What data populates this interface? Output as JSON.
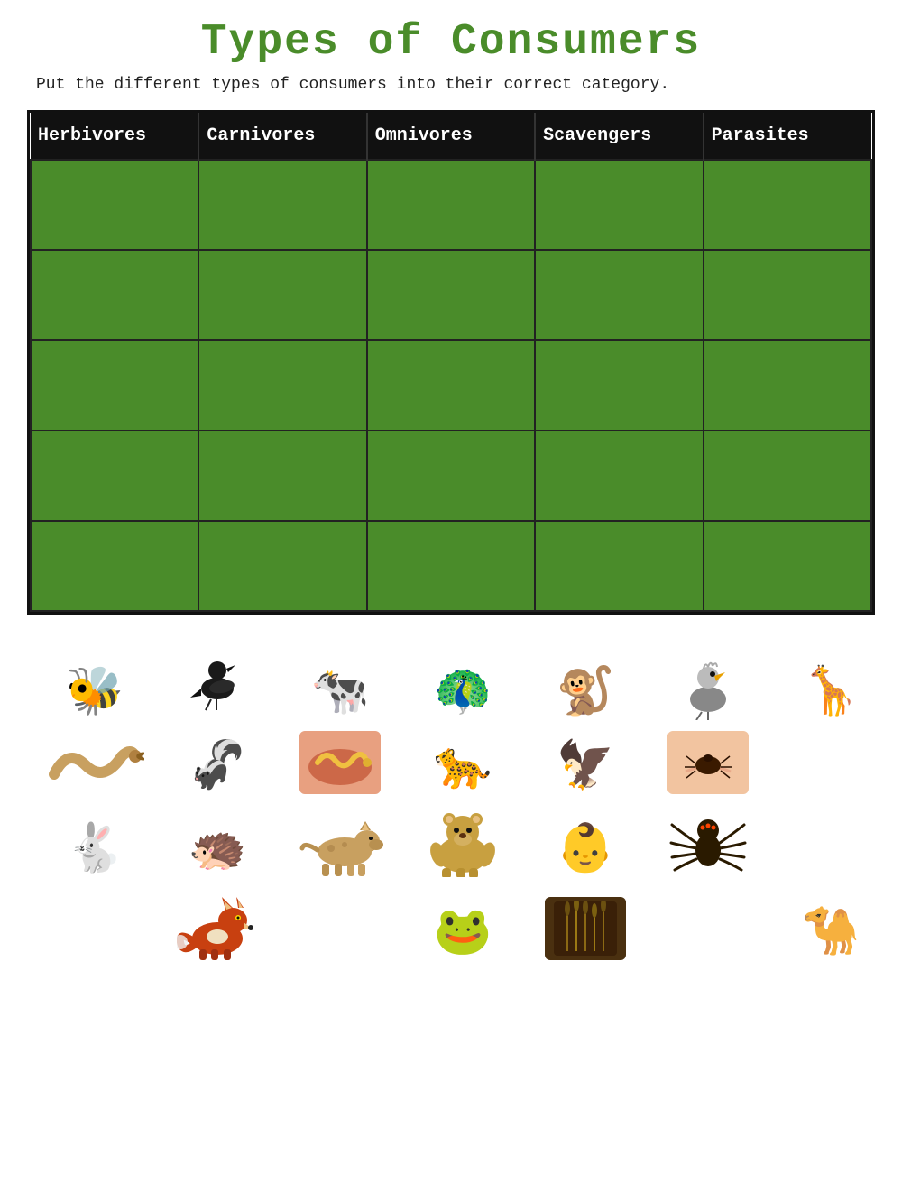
{
  "page": {
    "title": "Types of Consumers",
    "subtitle": "Put the different types of consumers into their correct category.",
    "table": {
      "headers": [
        "Herbivores",
        "Carnivores",
        "Omnivores",
        "Scavengers",
        "Parasites"
      ],
      "rows": 5
    },
    "animals": [
      {
        "id": "bee",
        "icon": "🐝",
        "label": "Bee",
        "size": "normal"
      },
      {
        "id": "crow",
        "icon": "🐦",
        "label": "Crow",
        "size": "normal"
      },
      {
        "id": "cow",
        "icon": "🐄",
        "label": "Cow",
        "size": "normal"
      },
      {
        "id": "peacock",
        "icon": "🦚",
        "label": "Peacock",
        "size": "normal"
      },
      {
        "id": "monkey",
        "icon": "🐒",
        "label": "Monkey",
        "size": "normal"
      },
      {
        "id": "vulture",
        "icon": "🦅",
        "label": "Vulture",
        "size": "normal"
      },
      {
        "id": "giraffe",
        "icon": "🦒",
        "label": "Giraffe",
        "size": "normal"
      },
      {
        "id": "snake",
        "icon": "🐍",
        "label": "Snake",
        "size": "normal"
      },
      {
        "id": "skunk",
        "icon": "🦨",
        "label": "Skunk",
        "size": "normal"
      },
      {
        "id": "worm",
        "icon": "🪱",
        "label": "Parasite worm",
        "size": "normal"
      },
      {
        "id": "leopard",
        "icon": "🐆",
        "label": "Leopard",
        "size": "normal"
      },
      {
        "id": "eagle",
        "icon": "🦅",
        "label": "Eagle",
        "size": "normal"
      },
      {
        "id": "tick",
        "icon": "🕷️",
        "label": "Tick",
        "size": "small"
      },
      {
        "id": "hedgehog",
        "icon": "🦔",
        "label": "Hedgehog",
        "size": "normal"
      },
      {
        "id": "hyena",
        "icon": "🐺",
        "label": "Hyena",
        "size": "normal"
      },
      {
        "id": "bear",
        "icon": "🐻",
        "label": "Bear",
        "size": "normal"
      },
      {
        "id": "baby",
        "icon": "👶",
        "label": "Baby (human)",
        "size": "normal"
      },
      {
        "id": "spider",
        "icon": "🕷️",
        "label": "Spider",
        "size": "normal"
      },
      {
        "id": "rabbit",
        "icon": "🐇",
        "label": "Rabbit",
        "size": "normal"
      },
      {
        "id": "fox",
        "icon": "🦊",
        "label": "Fox",
        "size": "normal"
      },
      {
        "id": "frog",
        "icon": "🐸",
        "label": "Frog",
        "size": "normal"
      },
      {
        "id": "grass",
        "icon": "🌾",
        "label": "Grass/wheat",
        "size": "normal"
      },
      {
        "id": "camel",
        "icon": "🐪",
        "label": "Camel",
        "size": "normal"
      }
    ]
  }
}
